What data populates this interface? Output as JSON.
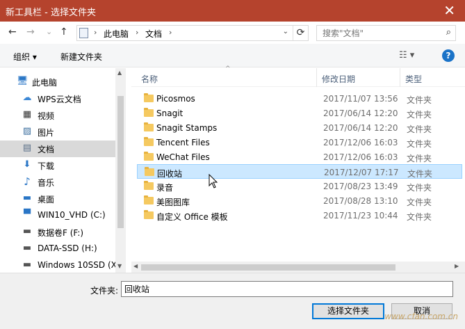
{
  "window": {
    "title": "新工具栏 - 选择文件夹",
    "close_glyph": "✕"
  },
  "address": {
    "segments": [
      "此电脑",
      "文档"
    ],
    "separator": "›",
    "back_glyph": "←",
    "forward_glyph": "→",
    "recent_glyph": "⌄",
    "up_glyph": "↑",
    "dropdown_glyph": "⌄",
    "refresh_glyph": "⟳"
  },
  "search": {
    "placeholder": "搜索\"文档\"",
    "icon": "search-icon",
    "glyph": "⌕"
  },
  "toolbar": {
    "organize_label": "组织 ▾",
    "new_folder_label": "新建文件夹",
    "view_glyph": "☷ ▾",
    "help_glyph": "?"
  },
  "nav": {
    "items": [
      {
        "label": "此电脑",
        "icon": "computer-icon",
        "glyph": "🖥"
      },
      {
        "label": "WPS云文档",
        "icon": "cloud-icon",
        "glyph": "☁"
      },
      {
        "label": "视频",
        "icon": "video-icon",
        "glyph": "▦"
      },
      {
        "label": "图片",
        "icon": "pictures-icon",
        "glyph": "▨"
      },
      {
        "label": "文档",
        "icon": "documents-icon",
        "glyph": "▤"
      },
      {
        "label": "下载",
        "icon": "download-icon",
        "glyph": "⬇"
      },
      {
        "label": "音乐",
        "icon": "music-icon",
        "glyph": "♪"
      },
      {
        "label": "桌面",
        "icon": "desktop-icon",
        "glyph": "▬"
      },
      {
        "label": "WIN10_VHD (C:)",
        "icon": "windows-drive-icon",
        "glyph": "▀"
      },
      {
        "label": "数据卷F (F:)",
        "icon": "drive-icon",
        "glyph": "▬"
      },
      {
        "label": "DATA-SSD (H:)",
        "icon": "drive-icon",
        "glyph": "▬"
      },
      {
        "label": "Windows 10SSD (X",
        "icon": "drive-icon",
        "glyph": "▬"
      }
    ],
    "selected_index": 4,
    "scroll_up_glyph": "▲",
    "scroll_down_glyph": "▼"
  },
  "files": {
    "columns": {
      "name": "名称",
      "date": "修改日期",
      "type": "类型"
    },
    "sort_glyph": "^",
    "rows": [
      {
        "name": "Picosmos",
        "date": "2017/11/07 13:56",
        "type": "文件夹"
      },
      {
        "name": "Snagit",
        "date": "2017/06/14 12:20",
        "type": "文件夹"
      },
      {
        "name": "Snagit Stamps",
        "date": "2017/06/14 12:20",
        "type": "文件夹"
      },
      {
        "name": "Tencent Files",
        "date": "2017/12/06 16:03",
        "type": "文件夹"
      },
      {
        "name": "WeChat Files",
        "date": "2017/12/06 16:03",
        "type": "文件夹"
      },
      {
        "name": "回收站",
        "date": "2017/12/07 17:17",
        "type": "文件夹"
      },
      {
        "name": "录音",
        "date": "2017/08/23 13:49",
        "type": "文件夹"
      },
      {
        "name": "美图图库",
        "date": "2017/08/28 13:10",
        "type": "文件夹"
      },
      {
        "name": "自定义 Office 模板",
        "date": "2017/11/23 10:44",
        "type": "文件夹"
      }
    ],
    "selected_index": 5,
    "hscroll_left_glyph": "◀",
    "hscroll_right_glyph": "▶"
  },
  "footer": {
    "folder_label": "文件夹:",
    "folder_value": "回收站",
    "select_button": "选择文件夹",
    "cancel_button": "取消"
  },
  "watermark": "www.cfan.com.cn",
  "colors": {
    "titlebar": "#b5432d",
    "accent": "#0078d7",
    "selection": "#cce8ff"
  }
}
